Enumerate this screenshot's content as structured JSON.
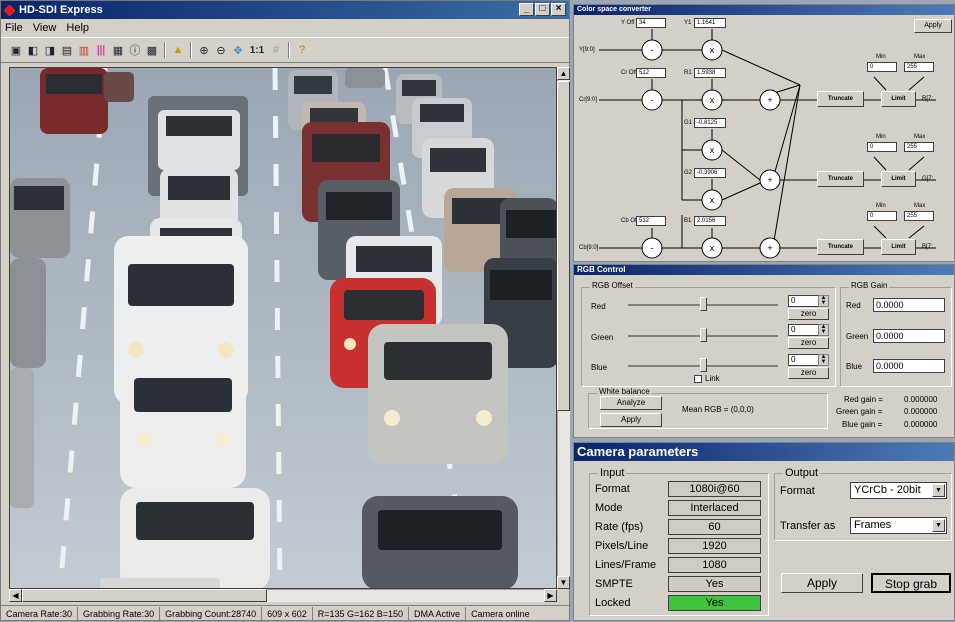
{
  "main_window": {
    "title": "HD-SDI Express",
    "menu": [
      "File",
      "View",
      "Help"
    ],
    "toolbar_zoom_label": "1:1"
  },
  "status_bar": {
    "camera_rate": "Camera Rate:30",
    "grabbing_rate": "Grabbing Rate:30",
    "grabbing_count": "Grabbing Count:28740",
    "resolution": "609 x 602",
    "pixel_value": "R=135 G=162 B=150",
    "dma": "DMA Active",
    "camera_status": "Camera online"
  },
  "color_converter": {
    "title": "Color space converter",
    "apply_label": "Apply",
    "y_off_label": "Y Off",
    "y_off_value": "34",
    "cr_off_label": "Cr Off",
    "cr_off_value": "512",
    "cb_off_label": "Cb Off",
    "cb_off_value": "512",
    "y1_label": "Y1",
    "y1_value": "1.1641",
    "r1_label": "R1",
    "r1_value": "1.5938",
    "g1_label": "G1",
    "g1_value": "-0.8125",
    "g2_label": "G2",
    "g2_value": "-0.3906",
    "b1_label": "B1",
    "b1_value": "2.0156",
    "y_input": "Y[9:0]",
    "c_input": "Cr[9:0]",
    "cb_input": "Cb[9:0]",
    "r_output": "R[7:",
    "g_output": "G[7:",
    "b_output": "B[7:",
    "truncate_label": "Truncate",
    "limit_label": "Limit",
    "min_label": "Min",
    "max_label": "Max",
    "min_value": "0",
    "max_value": "255"
  },
  "rgb_control": {
    "title": "RGB Control",
    "offset_group": "RGB Offset",
    "gain_group": "RGB Gain",
    "red_label": "Red",
    "green_label": "Green",
    "blue_label": "Blue",
    "red_offset": "0",
    "green_offset": "0",
    "blue_offset": "0",
    "zero_label": "zero",
    "link_label": "Link",
    "red_gain": "0.0000",
    "green_gain": "0.0000",
    "blue_gain": "0.0000",
    "wb_group": "White balance",
    "analyze_label": "Analyze",
    "apply_label": "Apply",
    "mean_rgb": "Mean RGB = (0,0,0)",
    "red_gain_text": "Red gain =",
    "red_gain_val": "0.000000",
    "green_gain_text": "Green gain =",
    "green_gain_val": "0.000000",
    "blue_gain_text": "Blue gain =",
    "blue_gain_val": "0.000000"
  },
  "camera_params": {
    "title": "Camera parameters",
    "input_group": "Input",
    "output_group": "Output",
    "format_label": "Format",
    "format_value": "1080i@60",
    "mode_label": "Mode",
    "mode_value": "Interlaced",
    "rate_label": "Rate (fps)",
    "rate_value": "60",
    "pixels_label": "Pixels/Line",
    "pixels_value": "1920",
    "lines_label": "Lines/Frame",
    "lines_value": "1080",
    "smpte_label": "SMPTE",
    "smpte_value": "Yes",
    "locked_label": "Locked",
    "locked_value": "Yes",
    "out_format_label": "Format",
    "out_format_value": "YCrCb - 20bit",
    "transfer_label": "Transfer as",
    "transfer_value": "Frames",
    "apply_label": "Apply",
    "stop_label": "Stop grab"
  },
  "colors": {
    "title_blue": "#0a246a",
    "locked_green": "#3ec33e"
  }
}
